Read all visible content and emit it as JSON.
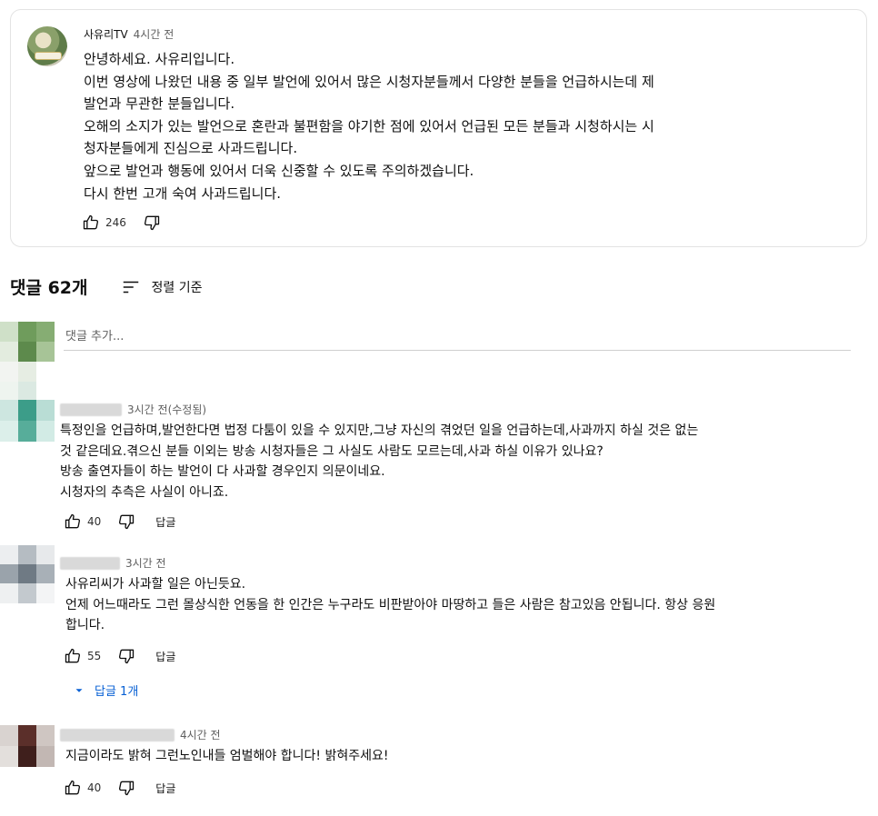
{
  "post": {
    "channel": "사유리TV",
    "time": "4시간 전",
    "lines": [
      "안녕하세요. 사유리입니다.",
      "이번 영상에 나왔던 내용 중 일부 발언에 있어서 많은 시청자분들께서 다양한 분들을 언급하시는데 제",
      "발언과 무관한 분들입니다.",
      "오해의 소지가 있는 발언으로 혼란과 불편함을 야기한 점에 있어서 언급된 모든 분들과 시청하시는 시",
      "청자분들에게 진심으로 사과드립니다.",
      "앞으로 발언과 행동에 있어서 더욱 신중할 수 있도록 주의하겠습니다.",
      "다시 한번 고개 숙여 사과드립니다."
    ],
    "likes": "246",
    "like_icon": "thumbs-up-icon",
    "dislike_icon": "thumbs-down-icon"
  },
  "comments_section": {
    "title": "댓글 62개",
    "sort_label": "정렬 기준",
    "sort_icon": "sort-icon",
    "add_placeholder": "댓글 추가..."
  },
  "comments": [
    {
      "time": "3시간 전(수정됨)",
      "lines": [
        "특정인을 언급하며,발언한다면 법정 다툼이 있을 수 있지만,그냥 자신의 겪었던 일을 언급하는데,사과까지 하실 것은 없는",
        "것 같은데요.겪으신 분들 이외는 방송 시청자들은 그 사실도 사람도 모르는데,사과 하실 이유가 있나요?",
        "방송 출연자들이 하는 발언이 다 사과할 경우인지 의문이네요.",
        "시청자의 추측은 사실이 아니죠."
      ],
      "likes": "40",
      "reply_label": "답글"
    },
    {
      "time": "3시간 전",
      "lines": [
        "사유리씨가 사과할 일은 아닌듯요.",
        "언제 어느때라도 그런 몰상식한 언동을 한 인간은 누구라도 비판받아야 마땅하고 들은 사람은 참고있음 안됩니다. 항상 응원",
        "합니다."
      ],
      "likes": "55",
      "reply_label": "답글",
      "replies_label": "답글 1개"
    },
    {
      "time": "4시간 전",
      "lines": [
        "지금이라도  밝혀  그런노인내들 엄벌해야 합니다!  밝혀주세요!"
      ],
      "likes": "40",
      "reply_label": "답글"
    }
  ]
}
